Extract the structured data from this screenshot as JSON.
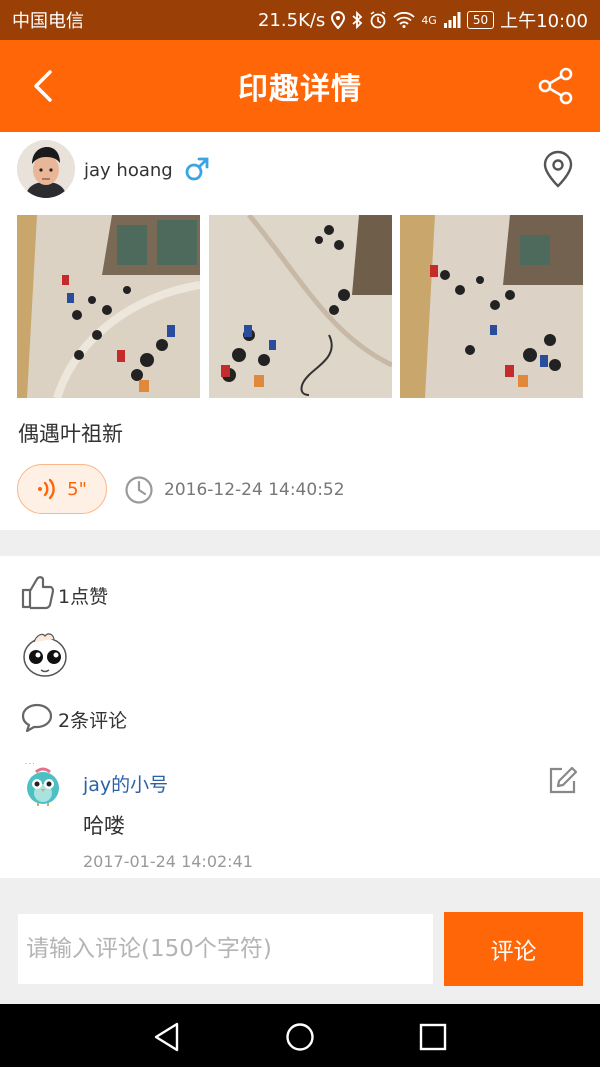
{
  "status_bar": {
    "carrier": "中国电信",
    "speed": "21.5K/s",
    "network": "4G",
    "battery": "50",
    "time": "上午10:00"
  },
  "header": {
    "title": "印趣详情",
    "back_icon": "back-arrow-icon",
    "share_icon": "share-icon",
    "background": "#fe6608"
  },
  "post": {
    "username": "jay hoang",
    "gender_icon": "male-icon",
    "location_icon": "location-pin-icon",
    "photos": [
      "mall-crowd-photo-1",
      "mall-crowd-photo-2",
      "mall-crowd-photo-3"
    ],
    "caption": "偶遇叶祖新",
    "voice_duration": "5\"",
    "timestamp": "2016-12-24 14:40:52"
  },
  "likes": {
    "label": "1点赞"
  },
  "comments": {
    "label": "2条评论",
    "items": [
      {
        "author": "jay的小号",
        "text": "哈喽",
        "time": "2017-01-24 14:02:41"
      }
    ]
  },
  "comment_box": {
    "placeholder": "请输入评论(150个字符)",
    "submit_label": "评论"
  },
  "colors": {
    "accent": "#fe6608",
    "link": "#2b62a6"
  }
}
